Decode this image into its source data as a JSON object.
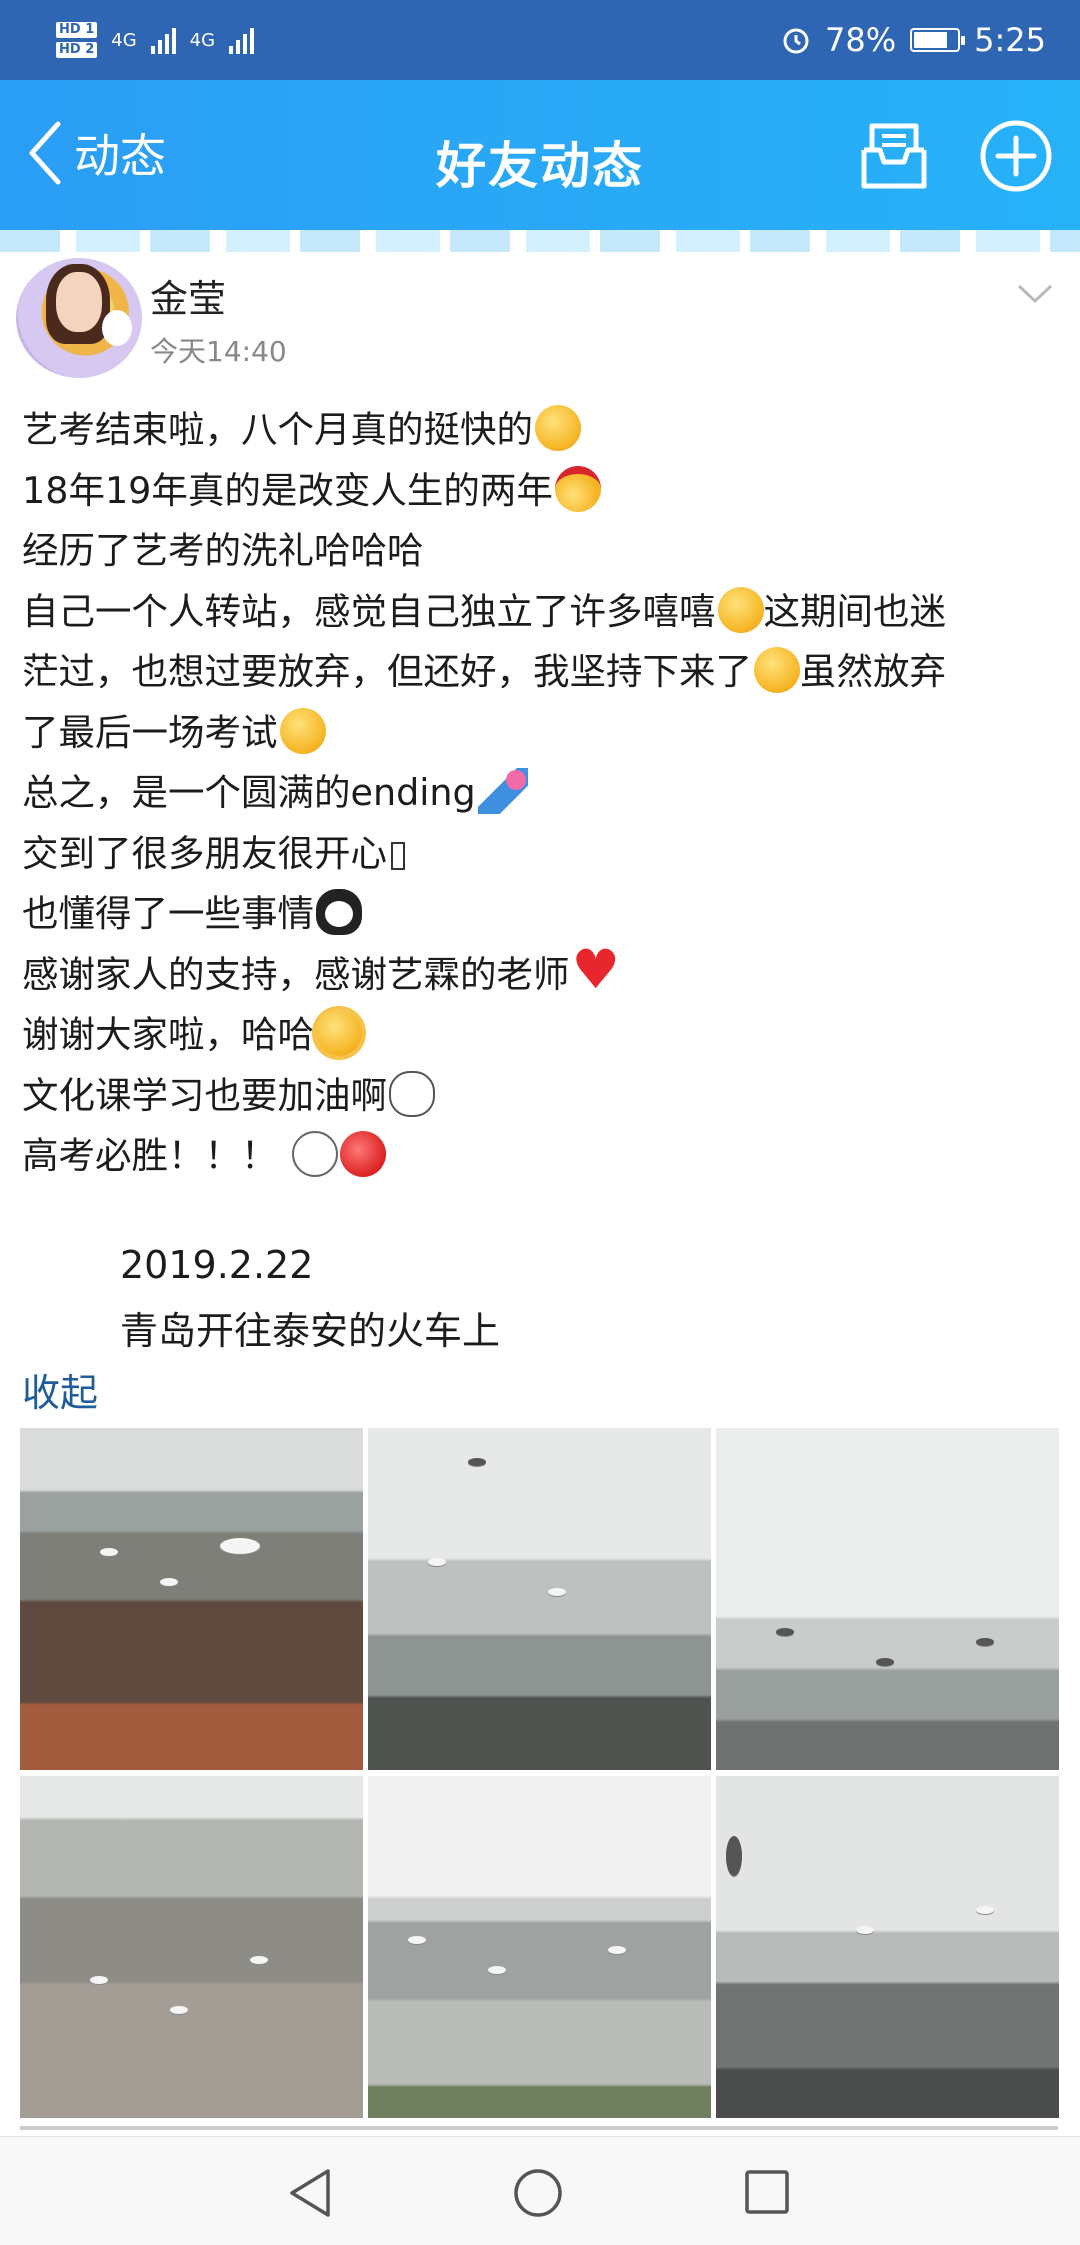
{
  "status_bar": {
    "left_badges": [
      "HD 1",
      "HD 2"
    ],
    "network": [
      "4G",
      "4G"
    ],
    "battery_percent": "78%",
    "battery_level": 0.78,
    "time": "5:25",
    "alarm_icon": "alarm-clock-icon"
  },
  "nav": {
    "back_label": "动态",
    "title": "好友动态",
    "icons": [
      "message-box-icon",
      "add-circle-icon"
    ]
  },
  "post": {
    "author": "金莹",
    "time": "今天14:40",
    "lines": [
      {
        "text": "艺考结束啦，八个月真的挺快的",
        "emoji": "grinning-face"
      },
      {
        "text": "18年19年真的是改变人生的两年",
        "emoji": "headband-face"
      },
      {
        "text": "经历了艺考的洗礼哈哈哈",
        "emoji": ""
      },
      {
        "text": "自己一个人转站，感觉自己独立了许多嘻嘻",
        "emoji": "hug-face",
        "tail": "这期间也迷"
      },
      {
        "text": "茫过，也想过要放弃，但还好，我坚持下来了",
        "emoji": "kiss-face",
        "tail": "虽然放弃"
      },
      {
        "text": "了最后一场考试",
        "emoji": "laughing-tears-face"
      },
      {
        "text": "总之，是一个圆满的ending",
        "emoji": "party-popper"
      },
      {
        "text": "交到了很多朋友很开心",
        "emoji": "missing-glyph"
      },
      {
        "text": "也懂得了一些事情",
        "emoji": "penguin"
      },
      {
        "text": "感谢家人的支持，感谢艺霖的老师",
        "emoji": "red-heart"
      },
      {
        "text": "谢谢大家啦，哈哈",
        "emoji": "sun-face"
      },
      {
        "text": "文化课学习也要加油啊",
        "emoji": "bear-face"
      },
      {
        "text": "高考必胜！！！",
        "emoji": "fighting-faces"
      }
    ],
    "date": "2019.2.22",
    "place": "青岛开往泰安的火车上",
    "collapse_label": "收起",
    "photos": [
      "seagulls-beach-1",
      "seagulls-sea-2",
      "seagulls-sea-3",
      "seagulls-beach-4",
      "seagulls-shore-5",
      "seagulls-shore-6"
    ]
  },
  "colors": {
    "status_bar": "#2f66b3",
    "nav_bar": "#2aa7f6",
    "link": "#1f5c99"
  },
  "system_nav": [
    "back-triangle-icon",
    "home-circle-icon",
    "recents-square-icon"
  ]
}
